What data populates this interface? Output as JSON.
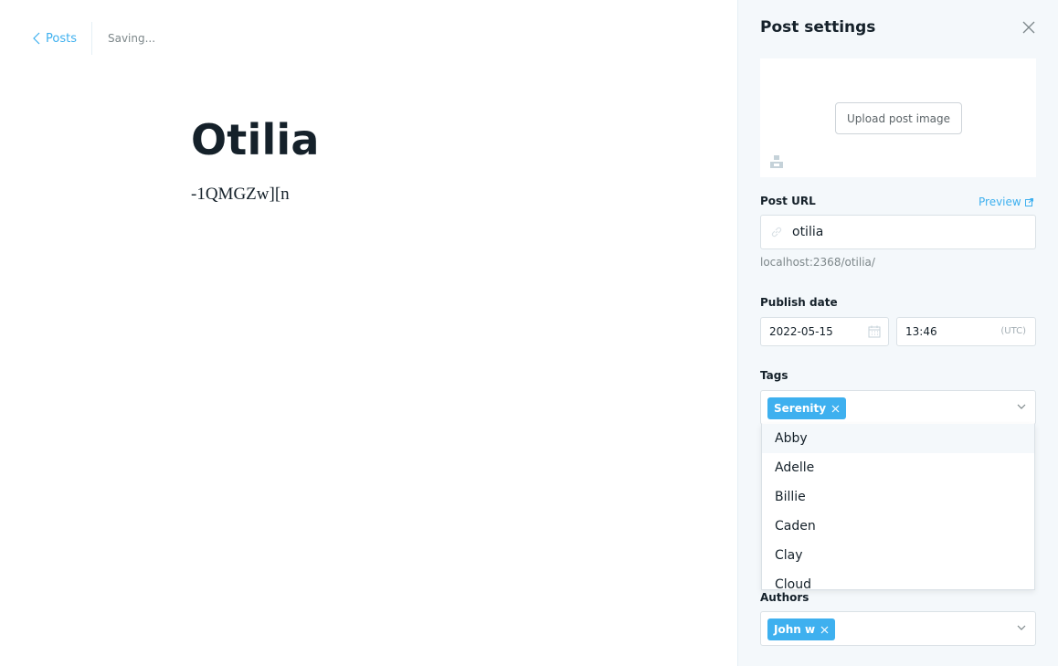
{
  "nav": {
    "back_label": "Posts",
    "status": "Saving..."
  },
  "post": {
    "title": "Otilia",
    "body": "-1QMGZw][n"
  },
  "settings": {
    "title": "Post settings",
    "upload_label": "Upload post image",
    "url_label": "Post URL",
    "preview_label": "Preview",
    "url_value": "otilia",
    "url_hint": "localhost:2368/otilia/",
    "publish_label": "Publish date",
    "date_value": "2022-05-15",
    "time_value": "13:46",
    "timezone": "(UTC)",
    "tags_label": "Tags",
    "tags": [
      "Serenity"
    ],
    "tag_options": [
      "Abby",
      "Adelle",
      "Billie",
      "Caden",
      "Clay",
      "Cloud"
    ],
    "authors_label": "Authors",
    "authors": [
      "John w"
    ]
  },
  "colors": {
    "accent": "#3eb0ef",
    "panel_bg": "#f4f8fb",
    "text": "#15212a"
  }
}
